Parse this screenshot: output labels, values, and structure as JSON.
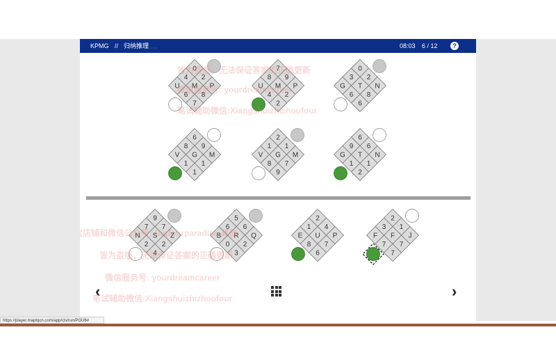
{
  "header": {
    "brand": "KPMG",
    "separator": "//",
    "section_title": "归纳推理",
    "timer": "08:03",
    "progress": "6 / 12",
    "help_icon": "?"
  },
  "puzzle": {
    "question_figures": [
      {
        "cells": [
          "0",
          "4",
          "2",
          "U",
          "M",
          "P",
          "6",
          "8",
          "7"
        ],
        "markers": {
          "top": "gray",
          "bottom": "empty"
        }
      },
      {
        "cells": [
          "7",
          "8",
          "9",
          "U",
          "M",
          "P",
          "4",
          "2",
          "2"
        ],
        "markers": {
          "top": "none",
          "bottom": "green"
        }
      },
      {
        "cells": [
          "0",
          "3",
          "2",
          "G",
          "T",
          "N",
          "6",
          "8",
          "6"
        ],
        "markers": {
          "top": "gray",
          "bottom": "empty"
        }
      },
      {
        "cells": [
          "6",
          "8",
          "9",
          "V",
          "G",
          "M",
          "1",
          "1",
          "1"
        ],
        "markers": {
          "top": "empty",
          "bottom": "green"
        }
      },
      {
        "cells": [
          "2",
          "1",
          "1",
          "V",
          "G",
          "M",
          "8",
          "7",
          "9"
        ],
        "markers": {
          "top": "gray",
          "bottom": "empty"
        }
      },
      {
        "cells": [
          "6",
          "9",
          "6",
          "G",
          "T",
          "N",
          "1",
          "1",
          "2"
        ],
        "markers": {
          "top": "empty",
          "bottom": "green"
        }
      }
    ],
    "answer_options": [
      {
        "cells": [
          "9",
          "7",
          "7",
          "N",
          "S",
          "Z",
          "2",
          "2",
          "4"
        ],
        "markers": {
          "top": "gray",
          "bottom": "empty"
        },
        "selected": false
      },
      {
        "cells": [
          "5",
          "6",
          "6",
          "B",
          "R",
          "Q",
          "0",
          "2",
          "3"
        ],
        "markers": {
          "top": "gray",
          "bottom": "empty"
        },
        "selected": false
      },
      {
        "cells": [
          "2",
          "1",
          "4",
          "E",
          "U",
          "P",
          "8",
          "7",
          "6"
        ],
        "markers": {
          "top": "none",
          "bottom": "green"
        },
        "selected": false
      },
      {
        "cells": [
          "2",
          "3",
          "1",
          "F",
          "F",
          "J",
          "7",
          "7",
          "7"
        ],
        "markers": {
          "top": "empty",
          "bottom": "green"
        },
        "selected": true
      }
    ]
  },
  "navigation": {
    "prev_icon": "‹",
    "next_icon": "›"
  },
  "watermarks": [
    "…",
    "皆为盗版，无法保证答案的正确更新",
    "微信服务号: yourdreamcareer",
    "笔试辅助微信:Xiangshuizhizhoufour",
    "淘宝店铺和微信公众号: Bigfourparadise,其他",
    "皆为盗版，无法保证答案的正确更新",
    "微信服务号: yourdreamcareer",
    "笔试辅助微信:Xiangshuizhizhoufour"
  ],
  "status_url": "https://player.maptqcn.com/app/cls/run/PGU6#",
  "colors": {
    "header_bg": "#0c2f8a",
    "green": "#4a9a3c",
    "gray_marker": "#c8c8c8",
    "cell_fill": "#dcdcdc",
    "divider": "#9e9e9e",
    "side_bg": "#e9e9e9"
  }
}
